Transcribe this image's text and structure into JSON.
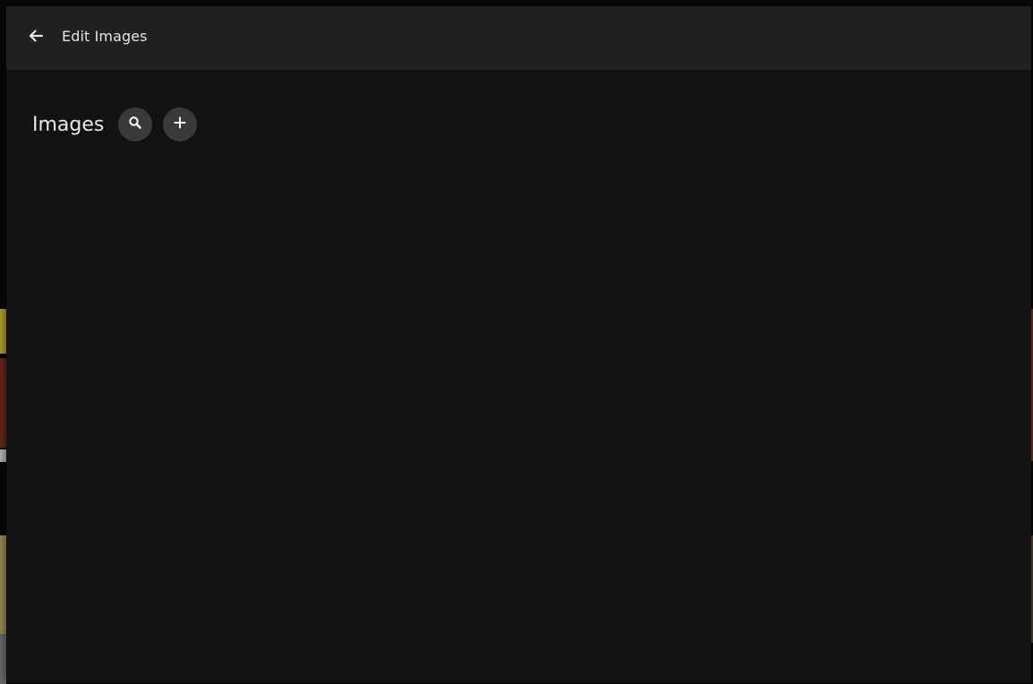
{
  "dialog": {
    "title": "Edit Images",
    "back_icon": "arrow-left-icon"
  },
  "section": {
    "title": "Images",
    "search_icon": "search-icon",
    "add_icon": "plus-icon"
  },
  "colors": {
    "dialog_background": "#121212",
    "header_background": "#202020",
    "button_background": "#3a3a3a",
    "text": "#e8e8e8"
  }
}
